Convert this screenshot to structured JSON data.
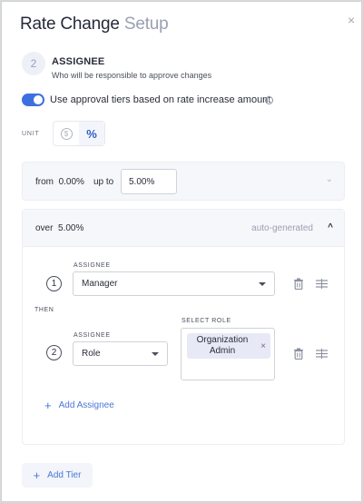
{
  "header": {
    "title_main": "Rate Change",
    "title_sub": "Setup",
    "close_label": "×"
  },
  "step": {
    "number": "2",
    "title": "ASSIGNEE",
    "subtitle": "Who will be responsible to approve changes"
  },
  "approval_toggle": {
    "label": "Use approval tiers based on rate increase amount",
    "enabled": true,
    "info_symbol": "i"
  },
  "unit": {
    "label": "UNIT",
    "options": [
      {
        "icon": "dollar-icon",
        "glyph": "$"
      },
      {
        "icon": "percent-icon",
        "glyph": "%"
      }
    ],
    "selected": "%"
  },
  "tiers": {
    "tier1": {
      "from_label": "from",
      "from_value": "0.00%",
      "upto_label": "up to",
      "upto_value": "5.00%",
      "chevron": "⌄"
    },
    "tier2": {
      "over_label": "over",
      "over_value": "5.00%",
      "auto_label": "auto-generated",
      "chevron": "^",
      "assignees": [
        {
          "number": "1",
          "label": "ASSIGNEE",
          "value": "Manager"
        },
        {
          "number": "2",
          "label": "ASSIGNEE",
          "value": "Role"
        }
      ],
      "then_label": "THEN",
      "select_role_label": "SELECT ROLE",
      "role_chip": "Organization Admin",
      "chip_close": "×",
      "add_assignee_label": "Add Assignee",
      "plus_glyph": "+"
    }
  },
  "add_tier_label": "Add Tier",
  "colors": {
    "accent": "#3d6fe0",
    "link": "#4a76d8",
    "chip_bg": "#e8e9f6"
  }
}
